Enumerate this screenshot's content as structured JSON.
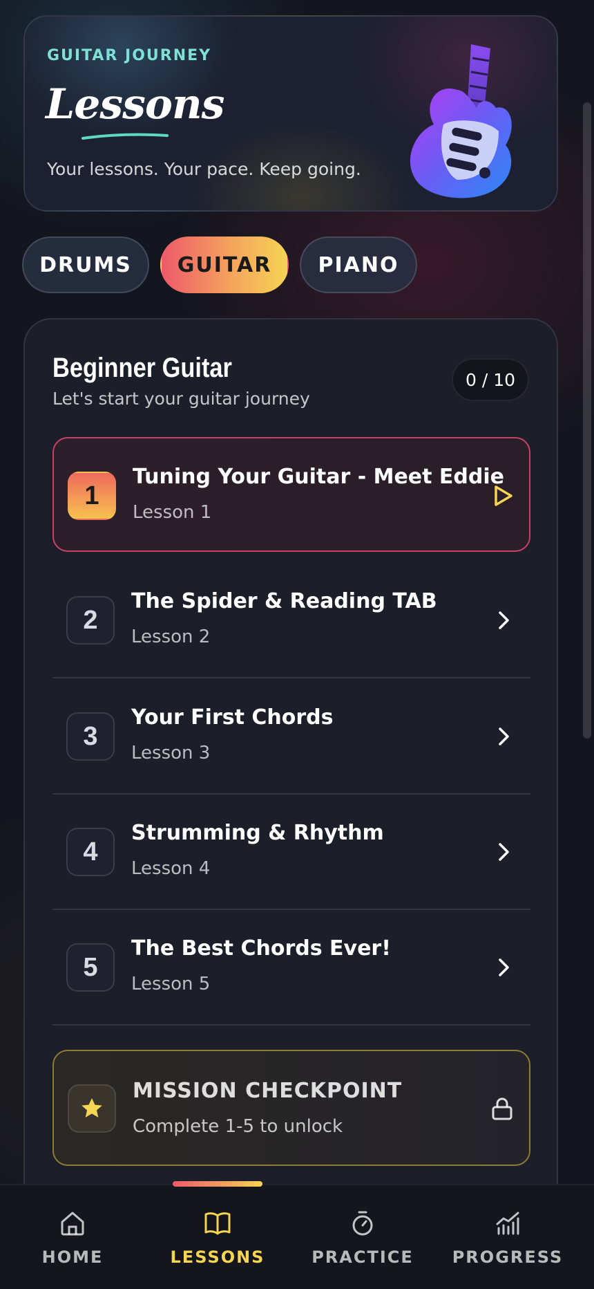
{
  "header": {
    "eyebrow": "GUITAR JOURNEY",
    "title": "Lessons",
    "tagline": "Your lessons. Your pace. Keep going."
  },
  "instrument_tabs": [
    {
      "label": "DRUMS",
      "active": false
    },
    {
      "label": "GUITAR",
      "active": true
    },
    {
      "label": "PIANO",
      "active": false
    }
  ],
  "course": {
    "title": "Beginner Guitar",
    "subtitle": "Let's start your guitar journey",
    "progress": "0 / 10",
    "lessons": [
      {
        "number": "1",
        "title": "Tuning Your Guitar - Meet Eddie",
        "meta": "Lesson 1",
        "action_icon": "play-icon"
      },
      {
        "number": "2",
        "title": "The Spider & Reading TAB",
        "meta": "Lesson 2",
        "action_icon": "chevron-right-icon"
      },
      {
        "number": "3",
        "title": "Your First Chords",
        "meta": "Lesson 3",
        "action_icon": "chevron-right-icon"
      },
      {
        "number": "4",
        "title": "Strumming & Rhythm",
        "meta": "Lesson 4",
        "action_icon": "chevron-right-icon"
      },
      {
        "number": "5",
        "title": "The Best Chords Ever!",
        "meta": "Lesson 5",
        "action_icon": "chevron-right-icon"
      }
    ],
    "checkpoint": {
      "title": "MISSION CHECKPOINT",
      "subtitle": "Complete 1-5 to unlock",
      "icon": "star-icon",
      "status_icon": "lock-icon"
    }
  },
  "bottom_nav": [
    {
      "label": "HOME",
      "icon": "home-icon",
      "active": false
    },
    {
      "label": "LESSONS",
      "icon": "book-icon",
      "active": true
    },
    {
      "label": "PRACTICE",
      "icon": "stopwatch-icon",
      "active": false
    },
    {
      "label": "PROGRESS",
      "icon": "chart-icon",
      "active": false
    }
  ],
  "colors": {
    "accent_gradient_start": "#ee5a6a",
    "accent_gradient_end": "#f6d454",
    "eyebrow": "#7fe0d6",
    "active_lesson_border": "#c84268",
    "checkpoint_border": "#8b7d35"
  }
}
